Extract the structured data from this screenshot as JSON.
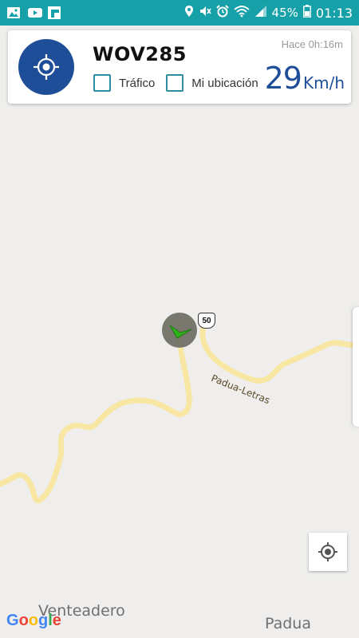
{
  "status_bar": {
    "battery": "45%",
    "time": "01:13",
    "left_icons": [
      "gallery-icon",
      "youtube-icon",
      "flipboard-icon"
    ],
    "right_icons": [
      "location-icon",
      "mute-icon",
      "alarm-icon",
      "wifi-icon",
      "signal-icon",
      "battery-icon"
    ],
    "color": "#16a0a8"
  },
  "vehicle_card": {
    "plate": "WOV285",
    "last_update": "Hace 0h:16m",
    "speed_value": "29",
    "speed_unit": "Km/h",
    "traffic_label": "Tráfico",
    "my_location_label": "Mi ubicación",
    "accent": "#1f4e99"
  },
  "map": {
    "route_shield": "50",
    "road_label": "Padua-Letras",
    "places": [
      "Venteadero",
      "Padua"
    ],
    "attribution": "Google"
  }
}
